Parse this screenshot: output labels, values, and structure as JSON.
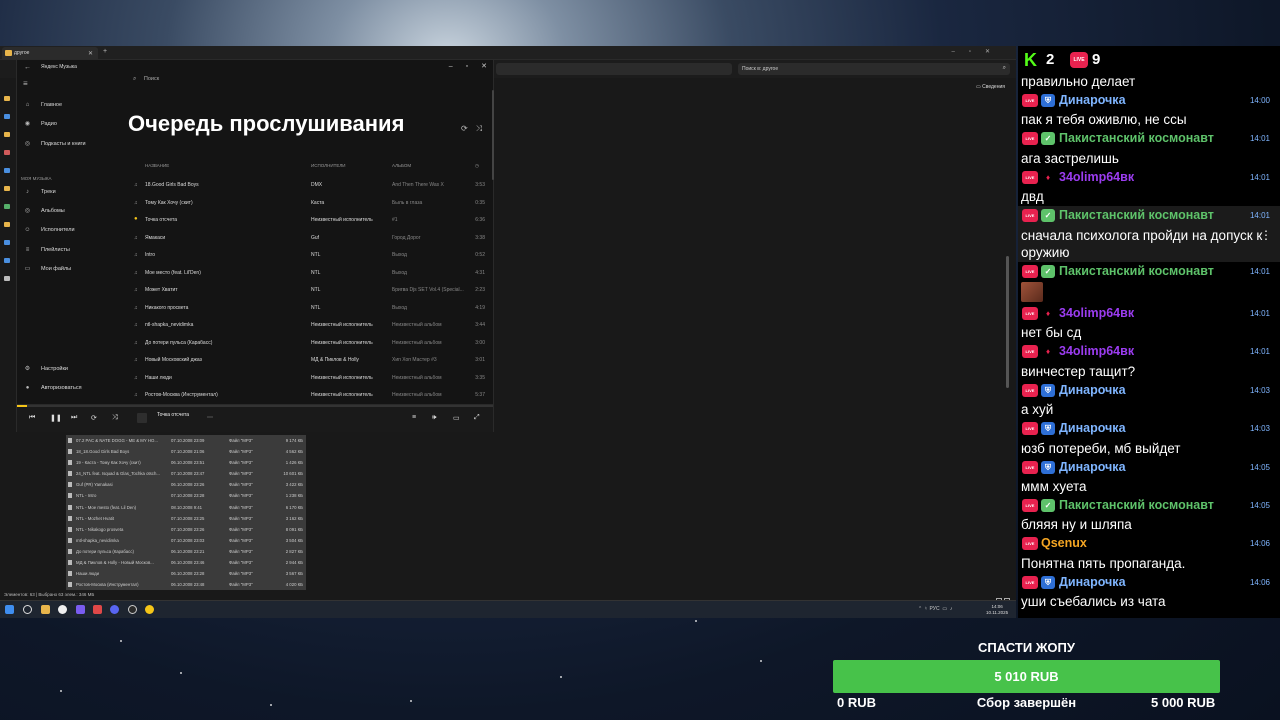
{
  "explorer": {
    "tab_title": "другое",
    "search_placeholder": "Поиск в: другое",
    "details_label": "Сведения",
    "status": "Элементов: 63  |  Выбрано 63 элем.: 346 МБ",
    "files": [
      {
        "name": "07.2 PAC & NATE DOGG - ME & MY HO...",
        "date": "07.10.2008 23:09",
        "type": "Файл \"MP3\"",
        "size": "9 174 КБ"
      },
      {
        "name": "18_18.Good Girls Bad Boys",
        "date": "07.10.2008 21:06",
        "type": "Файл \"MP3\"",
        "size": "4 562 КБ"
      },
      {
        "name": "19 - Каста - Тому Как Хочу (скит)",
        "date": "06.10.2008 23:51",
        "type": "Файл \"MP3\"",
        "size": "1 426 КБ"
      },
      {
        "name": "24_NTL feat. Isquad & Glas_Tochka otsch...",
        "date": "07.10.2008 23:47",
        "type": "Файл \"MP3\"",
        "size": "10 601 КБ"
      },
      {
        "name": "Guf (PR) Yamakasi",
        "date": "06.10.2008 23:26",
        "type": "Файл \"MP3\"",
        "size": "3 422 КБ"
      },
      {
        "name": "NTL - Intro",
        "date": "07.10.2008 23:28",
        "type": "Файл \"MP3\"",
        "size": "1 238 КБ"
      },
      {
        "name": "NTL - Moe mesto (feat. Lil Den)",
        "date": "08.10.2008 9:41",
        "type": "Файл \"MP3\"",
        "size": "6 170 КБ"
      },
      {
        "name": "NTL - Mozhet Hvatit",
        "date": "07.10.2008 23:25",
        "type": "Файл \"MP3\"",
        "size": "3 162 КБ"
      },
      {
        "name": "NTL - Nikakogo prosveta",
        "date": "07.10.2008 23:26",
        "type": "Файл \"MP3\"",
        "size": "8 091 КБ"
      },
      {
        "name": "mtl-shapka_nevidimka",
        "date": "07.10.2008 23:03",
        "type": "Файл \"MP3\"",
        "size": "3 504 КБ"
      },
      {
        "name": "До потери пульса (Карабасс)",
        "date": "06.10.2008 23:21",
        "type": "Файл \"MP3\"",
        "size": "2 827 КБ"
      },
      {
        "name": "МД & Пиклов & Holly - Новый Москов...",
        "date": "06.10.2008 23:46",
        "type": "Файл \"MP3\"",
        "size": "2 944 КБ"
      },
      {
        "name": "Наши люди",
        "date": "06.10.2008 23:28",
        "type": "Файл \"MP3\"",
        "size": "3 567 КБ"
      },
      {
        "name": "Ростов-Москва (Инструментал)",
        "date": "06.10.2008 23:48",
        "type": "Файл \"MP3\"",
        "size": "4 020 КБ"
      }
    ]
  },
  "music": {
    "app_title": "Яндекс Музыка",
    "search_placeholder": "Поиск",
    "nav_main": [
      {
        "label": "Главное",
        "icon": "home-icon",
        "glyph": "⌂"
      },
      {
        "label": "Радио",
        "icon": "radio-icon",
        "glyph": "◉"
      },
      {
        "label": "Подкасты и книги",
        "icon": "podcast-icon",
        "glyph": "◎"
      }
    ],
    "section_label": "Моя музыка",
    "nav_my": [
      {
        "label": "Треки",
        "icon": "note-icon",
        "glyph": "♪"
      },
      {
        "label": "Альбомы",
        "icon": "album-icon",
        "glyph": "◎"
      },
      {
        "label": "Исполнители",
        "icon": "artist-icon",
        "glyph": "☺"
      },
      {
        "label": "Плейлисты",
        "icon": "playlist-icon",
        "glyph": "≡"
      },
      {
        "label": "Мои файлы",
        "icon": "folder-icon",
        "glyph": "▭"
      }
    ],
    "nav_bottom": [
      {
        "label": "Настройки",
        "icon": "gear-icon",
        "glyph": "⚙"
      },
      {
        "label": "Авторизоваться",
        "icon": "user-icon",
        "glyph": "●"
      }
    ],
    "queue_title": "Очередь прослушивания",
    "columns": {
      "name": "Название",
      "artists": "Исполнители",
      "album": "Альбом"
    },
    "tracks": [
      {
        "name": "18.Good Girls Bad Boys",
        "artist": "DMX",
        "album": "And Then There Was X",
        "duration": "3:53",
        "playing": false
      },
      {
        "name": "Тому Как Хочу (скит)",
        "artist": "Каста",
        "album": "Быль в глаза",
        "duration": "0:35",
        "playing": false
      },
      {
        "name": "Точка отсчета",
        "artist": "Неизвестный исполнитель",
        "album": "#1",
        "duration": "6:36",
        "playing": true
      },
      {
        "name": "Ямакаси",
        "artist": "Guf",
        "album": "Город Дорог",
        "duration": "3:38",
        "playing": false
      },
      {
        "name": "Intro",
        "artist": "NTL",
        "album": "Выход",
        "duration": "0:52",
        "playing": false
      },
      {
        "name": "Мое место (feat. Lil'Den)",
        "artist": "NTL",
        "album": "Выход",
        "duration": "4:31",
        "playing": false
      },
      {
        "name": "Может Хватит",
        "artist": "NTL",
        "album": "Бригва Djs SET Vol.4 (Special...",
        "duration": "2:23",
        "playing": false
      },
      {
        "name": "Никакого просвета",
        "artist": "NTL",
        "album": "Выход",
        "duration": "4:19",
        "playing": false
      },
      {
        "name": "ntl-shapka_nevidimka",
        "artist": "Неизвестный исполнитель",
        "album": "Неизвестный альбом",
        "duration": "3:44",
        "playing": false
      },
      {
        "name": "До потери пульса (Карабасс)",
        "artist": "Неизвестный исполнитель",
        "album": "Неизвестный альбом",
        "duration": "3:00",
        "playing": false
      },
      {
        "name": "Новый Московский джаз",
        "artist": "МД & Пиклов & Holly",
        "album": "Хип Хоп Мастер #3",
        "duration": "3:01",
        "playing": false
      },
      {
        "name": "Наши люди",
        "artist": "Неизвестный исполнитель",
        "album": "Неизвестный альбом",
        "duration": "3:35",
        "playing": false
      },
      {
        "name": "Ростов-Москва (Инструментал)",
        "artist": "Неизвестный исполнитель",
        "album": "Неизвестный альбом",
        "duration": "5:37",
        "playing": false
      }
    ],
    "player": {
      "track": "Точка отсчета",
      "progress": 0.02
    },
    "accent": "#f5c518"
  },
  "taskbar": {
    "lang": "РУС",
    "time": "14:06",
    "date": "10.11.2025"
  },
  "chat": {
    "kick_count": "2",
    "live_count": "9",
    "live_badge": "LIVE",
    "messages": [
      {
        "user": "",
        "time": "",
        "text": "правильно делает",
        "badge": "",
        "color": "",
        "highlight": false,
        "emote": false
      },
      {
        "user": "Динарочка",
        "time": "14:00",
        "text": "пак я тебя оживлю, не ссы",
        "badge": "shield",
        "color": "#7fb5ff",
        "highlight": false,
        "emote": false
      },
      {
        "user": "Пакистанский космонавт",
        "time": "14:01",
        "text": "ага застрелишь",
        "badge": "check",
        "color": "#5ec26a",
        "highlight": false,
        "emote": false
      },
      {
        "user": "34olimp64вк",
        "time": "14:01",
        "text": "двд",
        "badge": "gem",
        "color": "#9b3cf0",
        "highlight": false,
        "emote": false
      },
      {
        "user": "Пакистанский космонавт",
        "time": "14:01",
        "text": "сначала психолога пройди на допуск к оружию",
        "badge": "check",
        "color": "#5ec26a",
        "highlight": true,
        "emote": false
      },
      {
        "user": "Пакистанский космонавт",
        "time": "14:01",
        "text": "",
        "badge": "check",
        "color": "#5ec26a",
        "highlight": false,
        "emote": true
      },
      {
        "user": "34olimp64вк",
        "time": "14:01",
        "text": "нет бы сд",
        "badge": "gem",
        "color": "#9b3cf0",
        "highlight": false,
        "emote": false
      },
      {
        "user": "34olimp64вк",
        "time": "14:01",
        "text": "винчестер тащит?",
        "badge": "gem",
        "color": "#9b3cf0",
        "highlight": false,
        "emote": false
      },
      {
        "user": "Динарочка",
        "time": "14:03",
        "text": "а хуй",
        "badge": "shield",
        "color": "#7fb5ff",
        "highlight": false,
        "emote": false
      },
      {
        "user": "Динарочка",
        "time": "14:03",
        "text": "юзб потереби, мб выйдет",
        "badge": "shield",
        "color": "#7fb5ff",
        "highlight": false,
        "emote": false
      },
      {
        "user": "Динарочка",
        "time": "14:05",
        "text": "ммм хуета",
        "badge": "shield",
        "color": "#7fb5ff",
        "highlight": false,
        "emote": false
      },
      {
        "user": "Пакистанский космонавт",
        "time": "14:05",
        "text": "бляяя ну и шляпа",
        "badge": "check",
        "color": "#5ec26a",
        "highlight": false,
        "emote": false
      },
      {
        "user": "Qsenux",
        "time": "14:06",
        "text": "Понятна пять пропаганда.",
        "badge": "",
        "color": "#f5a623",
        "highlight": false,
        "emote": false
      },
      {
        "user": "Динарочка",
        "time": "14:06",
        "text": "уши съебались из чата",
        "badge": "shield",
        "color": "#7fb5ff",
        "highlight": false,
        "emote": false
      }
    ]
  },
  "goal": {
    "title": "СПАСТИ ЖОПУ",
    "current": "5 010 RUB",
    "min": "0 RUB",
    "status": "Сбор завершён",
    "max": "5 000 RUB",
    "progress": 1.0,
    "color": "#47c24a"
  }
}
